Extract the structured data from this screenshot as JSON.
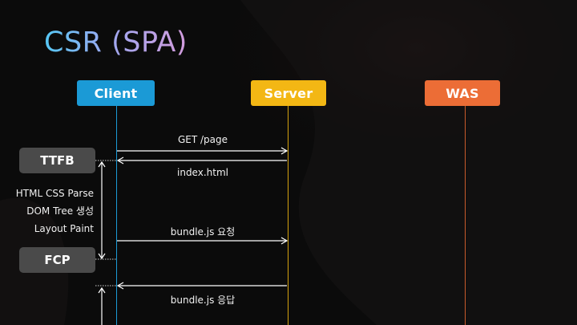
{
  "title": "CSR (SPA)",
  "actors": [
    {
      "name": "Client",
      "color": "#1b9ad6"
    },
    {
      "name": "Server",
      "color": "#f3b714"
    },
    {
      "name": "WAS",
      "color": "#ec6d36"
    }
  ],
  "messages": [
    {
      "label": "GET /page",
      "from": "Client",
      "to": "Server"
    },
    {
      "label": "index.html",
      "from": "Server",
      "to": "Client"
    },
    {
      "label": "bundle.js 요청",
      "from": "Client",
      "to": "Server"
    },
    {
      "label": "bundle.js 응답",
      "from": "Server",
      "to": "Client"
    }
  ],
  "milestones": {
    "ttfb": "TTFB",
    "fcp": "FCP"
  },
  "phases": [
    "HTML CSS Parse",
    "DOM Tree 생성",
    "Layout Paint"
  ]
}
